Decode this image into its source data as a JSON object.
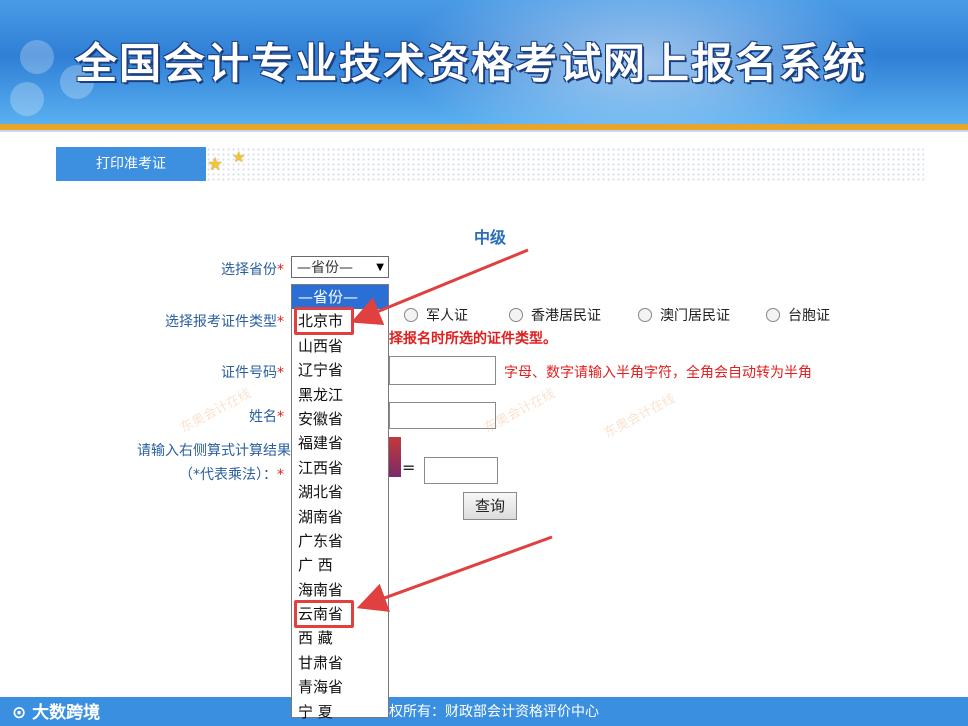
{
  "banner": {
    "title": "全国会计专业技术资格考试网上报名系统"
  },
  "tabs": {
    "print_ticket": "打印准考证"
  },
  "form": {
    "level_title": "中级",
    "province_label": "选择省份",
    "id_type_label": "选择报考证件类型",
    "id_number_label": "证件号码",
    "name_label": "姓名",
    "captcha_label_line1": "请输入右侧算式计算结果",
    "captcha_label_line2": "（*代表乘法）：",
    "required_mark": "*",
    "province_select_value": "—省份—",
    "id_types": [
      "军人证",
      "香港居民证",
      "澳门居民证",
      "台胞证"
    ],
    "id_type_hint": "择报名时所选的证件类型。",
    "id_number_hint": "字母、数字请输入半角字符，全角会自动转为半角",
    "captcha_equals": "=",
    "submit_button": "查询"
  },
  "province_dropdown": {
    "options": [
      "—省份—",
      "北京市",
      "山西省",
      "辽宁省",
      "黑龙江",
      "安徽省",
      "福建省",
      "江西省",
      "湖北省",
      "湖南省",
      "广东省",
      "广 西",
      "海南省",
      "云南省",
      "西 藏",
      "甘肃省",
      "青海省",
      "宁 夏"
    ],
    "selected_index": 0,
    "highlighted": [
      "北京市",
      "云南省"
    ]
  },
  "footer": {
    "copyright": "权所有：财政部会计资格评价中心",
    "logo": "大数跨境"
  },
  "watermarks": [
    "东奥会计在线",
    "东奥会计在线",
    "东奥会计在线"
  ],
  "colors": {
    "accent": "#3d8fe0",
    "required": "#e02020",
    "highlight": "#e04040",
    "label": "#2a5fa0"
  }
}
